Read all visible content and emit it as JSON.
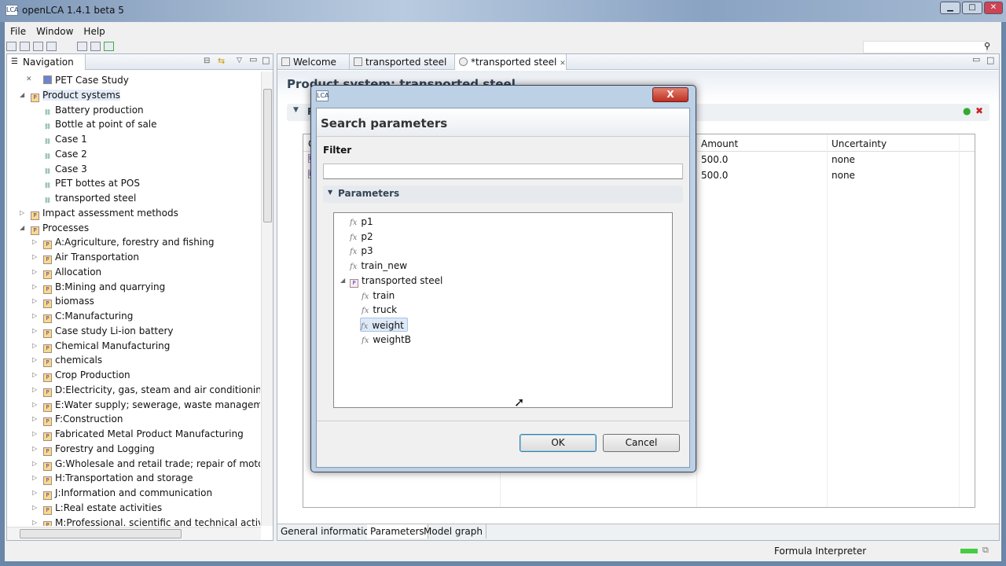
{
  "window": {
    "title": "openLCA 1.4.1 beta 5",
    "minimize": "▁",
    "maximize": "□",
    "close": "✕"
  },
  "menu": [
    "File",
    "Window",
    "Help"
  ],
  "navigation": {
    "title": "Navigation",
    "items": [
      {
        "label": "PET Case Study",
        "indent": 2,
        "type": "project"
      },
      {
        "label": "Product systems",
        "indent": 1,
        "expanded": true,
        "type": "folder"
      },
      {
        "label": "Battery production",
        "indent": 2,
        "type": "system"
      },
      {
        "label": "Bottle at point of sale",
        "indent": 2,
        "type": "system"
      },
      {
        "label": "Case 1",
        "indent": 2,
        "type": "system"
      },
      {
        "label": "Case 2",
        "indent": 2,
        "type": "system"
      },
      {
        "label": "Case 3",
        "indent": 2,
        "type": "system"
      },
      {
        "label": "PET bottes at POS",
        "indent": 2,
        "type": "system"
      },
      {
        "label": "transported steel",
        "indent": 2,
        "type": "system"
      },
      {
        "label": "Impact assessment methods",
        "indent": 1,
        "expanded": false,
        "type": "folder"
      },
      {
        "label": "Processes",
        "indent": 1,
        "expanded": true,
        "type": "folder"
      },
      {
        "label": "A:Agriculture, forestry and fishing",
        "indent": 2,
        "expanded": false,
        "type": "folder"
      },
      {
        "label": "Air Transportation",
        "indent": 2,
        "expanded": false,
        "type": "folder"
      },
      {
        "label": "Allocation",
        "indent": 2,
        "expanded": false,
        "type": "folder"
      },
      {
        "label": "B:Mining and quarrying",
        "indent": 2,
        "expanded": false,
        "type": "folder"
      },
      {
        "label": "biomass",
        "indent": 2,
        "expanded": false,
        "type": "folder"
      },
      {
        "label": "C:Manufacturing",
        "indent": 2,
        "expanded": false,
        "type": "folder"
      },
      {
        "label": "Case study Li-ion battery",
        "indent": 2,
        "expanded": false,
        "type": "folder"
      },
      {
        "label": "Chemical Manufacturing",
        "indent": 2,
        "expanded": false,
        "type": "folder"
      },
      {
        "label": "chemicals",
        "indent": 2,
        "expanded": false,
        "type": "folder"
      },
      {
        "label": "Crop Production",
        "indent": 2,
        "expanded": false,
        "type": "folder"
      },
      {
        "label": "D:Electricity, gas, steam and air conditioning su",
        "indent": 2,
        "expanded": false,
        "type": "folder"
      },
      {
        "label": "E:Water supply; sewerage, waste management a",
        "indent": 2,
        "expanded": false,
        "type": "folder"
      },
      {
        "label": "F:Construction",
        "indent": 2,
        "expanded": false,
        "type": "folder"
      },
      {
        "label": "Fabricated Metal Product Manufacturing",
        "indent": 2,
        "expanded": false,
        "type": "folder"
      },
      {
        "label": "Forestry and Logging",
        "indent": 2,
        "expanded": false,
        "type": "folder"
      },
      {
        "label": "G:Wholesale and retail trade; repair of motor ve",
        "indent": 2,
        "expanded": false,
        "type": "folder"
      },
      {
        "label": "H:Transportation and storage",
        "indent": 2,
        "expanded": false,
        "type": "folder"
      },
      {
        "label": "J:Information and communication",
        "indent": 2,
        "expanded": false,
        "type": "folder"
      },
      {
        "label": "L:Real estate activities",
        "indent": 2,
        "expanded": false,
        "type": "folder"
      },
      {
        "label": "M:Professional, scientific and technical activities",
        "indent": 2,
        "expanded": false,
        "type": "folder"
      }
    ]
  },
  "editor": {
    "tabs": [
      {
        "label": "Welcome"
      },
      {
        "label": "transported steel"
      },
      {
        "label": "*transported steel",
        "active": true
      }
    ],
    "title": "Product system: transported steel",
    "section": "Pa",
    "table": {
      "headers": [
        "C",
        "Amount",
        "Uncertainty"
      ],
      "rows": [
        [
          "P",
          "500.0",
          "none"
        ],
        [
          "P",
          "500.0",
          "none"
        ]
      ]
    },
    "bottom_tabs": [
      "General information",
      "Parameters",
      "Model graph"
    ],
    "active_bottom_tab": "Parameters"
  },
  "status": {
    "text": "Formula Interpreter"
  },
  "dialog": {
    "title": "Search parameters",
    "filter_label": "Filter",
    "filter_value": "",
    "section": "Parameters",
    "tree": [
      {
        "label": "p1",
        "indent": 0,
        "type": "param"
      },
      {
        "label": "p2",
        "indent": 0,
        "type": "param"
      },
      {
        "label": "p3",
        "indent": 0,
        "type": "param"
      },
      {
        "label": "train_new",
        "indent": 0,
        "type": "param"
      },
      {
        "label": "transported steel",
        "indent": 0,
        "type": "process",
        "expanded": true
      },
      {
        "label": "train",
        "indent": 1,
        "type": "param"
      },
      {
        "label": "truck",
        "indent": 1,
        "type": "param"
      },
      {
        "label": "weight",
        "indent": 1,
        "type": "param",
        "selected": true
      },
      {
        "label": "weightB",
        "indent": 1,
        "type": "param"
      }
    ],
    "ok": "OK",
    "cancel": "Cancel",
    "close": "X"
  }
}
